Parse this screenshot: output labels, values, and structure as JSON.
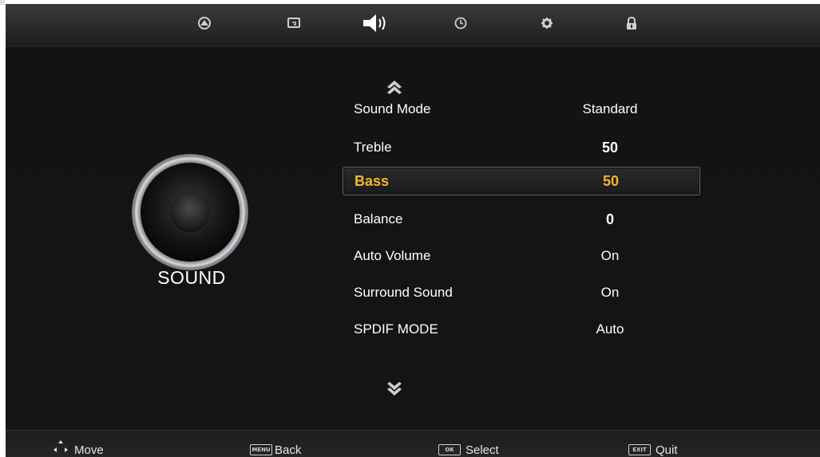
{
  "top_menu": {
    "icons": [
      "picture-icon",
      "input-source-icon",
      "sound-icon",
      "time-icon",
      "setup-icon",
      "lock-icon"
    ],
    "active": "sound-icon",
    "accent_color": "#ffffff"
  },
  "left_panel": {
    "title": "SOUND",
    "icon": "speaker-icon"
  },
  "menu": {
    "items": [
      {
        "label": "Sound Mode",
        "value": "Standard"
      },
      {
        "label": "Treble",
        "value": "50"
      },
      {
        "label": "Bass",
        "value": "50"
      },
      {
        "label": "Balance",
        "value": "0"
      },
      {
        "label": "Auto Volume",
        "value": "On"
      },
      {
        "label": "Surround Sound",
        "value": "On"
      },
      {
        "label": "SPDIF MODE",
        "value": "Auto"
      }
    ],
    "selected_label": "Bass",
    "highlight_color": "#f2b72b"
  },
  "footer": {
    "move": "Move",
    "back_key": "MENU",
    "back": "Back",
    "select_key": "OK",
    "select": "Select",
    "quit_key": "EXIT",
    "quit": "Quit"
  }
}
